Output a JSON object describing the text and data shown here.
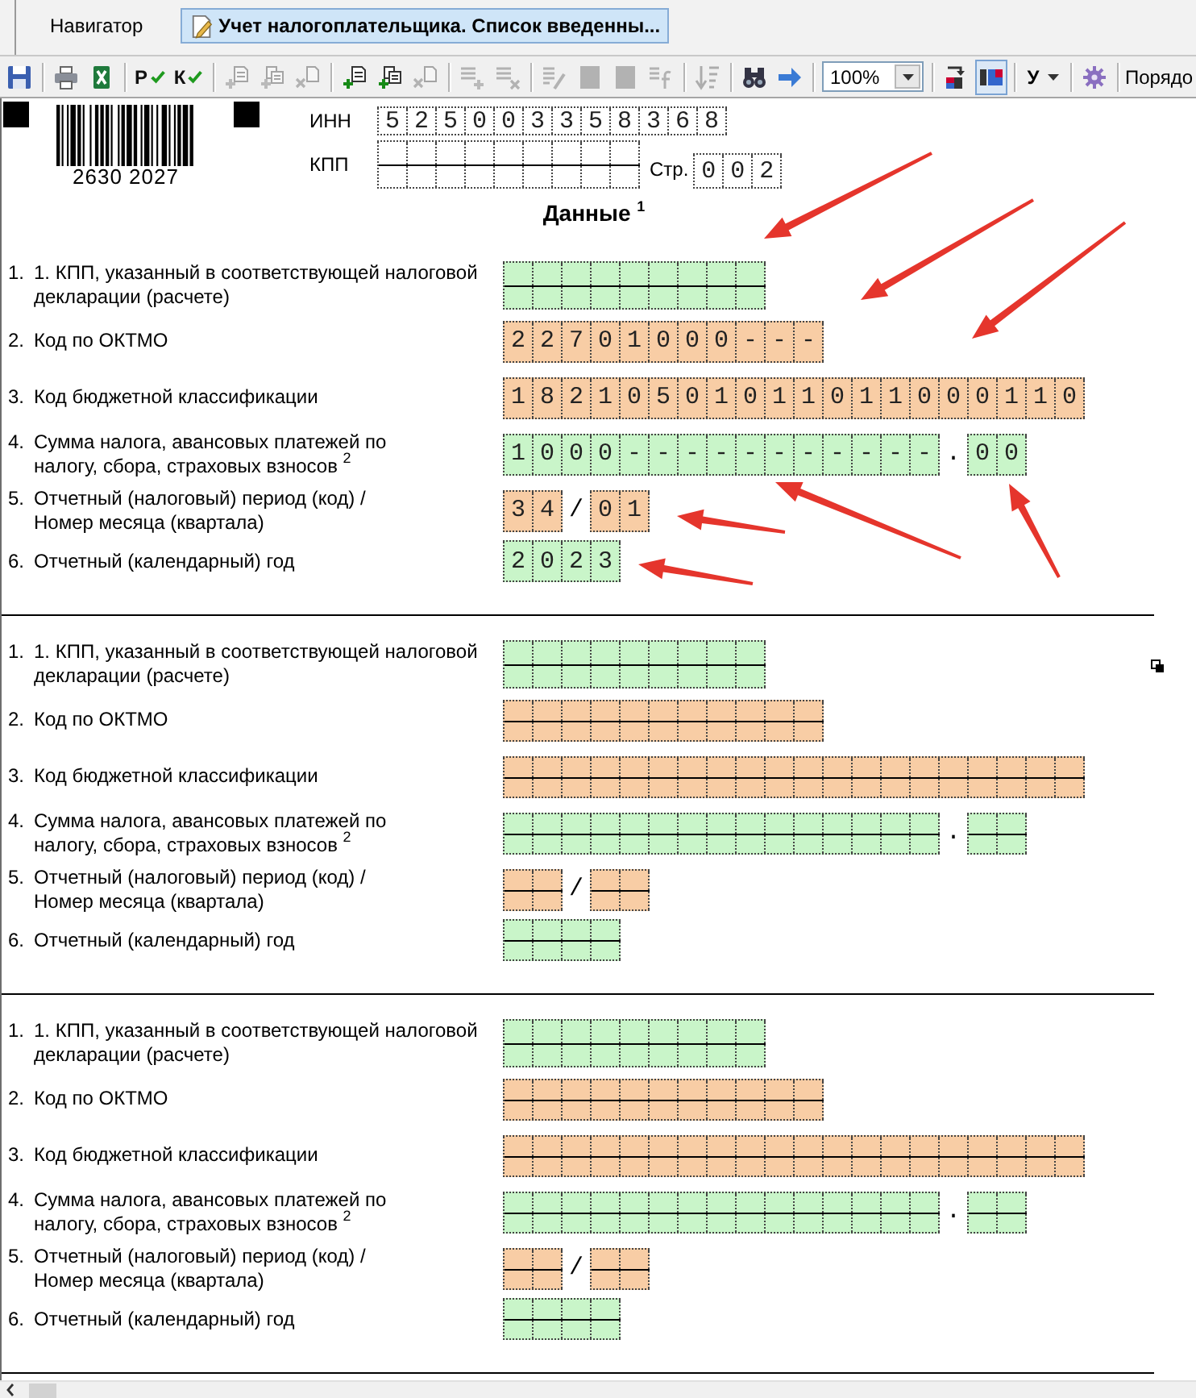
{
  "tabs": [
    {
      "kind": "plain",
      "label": "Навигатор",
      "selected": false
    },
    {
      "kind": "document",
      "label": "Учет налогоплательщика. Список введенны...",
      "selected": true
    }
  ],
  "toolbar": [
    [
      {
        "kind": "save",
        "disabled": false
      }
    ],
    [
      {
        "kind": "print",
        "disabled": false
      },
      {
        "kind": "excel",
        "disabled": false
      }
    ],
    [
      {
        "kind": "check",
        "label": "Р",
        "disabled": false
      },
      {
        "kind": "check",
        "label": "К",
        "disabled": false
      }
    ],
    [
      {
        "kind": "add-doc",
        "disabled": true
      },
      {
        "kind": "copy-doc",
        "disabled": true
      },
      {
        "kind": "delete-doc",
        "disabled": true
      }
    ],
    [
      {
        "kind": "add-doc",
        "disabled": false
      },
      {
        "kind": "copy-doc",
        "disabled": false
      },
      {
        "kind": "delete-doc",
        "disabled": true
      }
    ],
    [
      {
        "kind": "add-list",
        "disabled": true
      },
      {
        "kind": "delete-list",
        "disabled": true
      }
    ],
    [
      {
        "kind": "edit-list",
        "disabled": true
      },
      {
        "kind": "block",
        "disabled": true
      },
      {
        "kind": "block",
        "disabled": true
      },
      {
        "kind": "formula",
        "disabled": true
      }
    ],
    [
      {
        "kind": "sort",
        "disabled": true
      }
    ],
    [
      {
        "kind": "find",
        "disabled": false
      },
      {
        "kind": "next",
        "disabled": false
      }
    ],
    [
      {
        "kind": "combo",
        "value": "100%"
      }
    ],
    [
      {
        "kind": "layout",
        "disabled": false,
        "pressed": false
      },
      {
        "kind": "layout2",
        "disabled": false,
        "pressed": true
      }
    ],
    [
      {
        "kind": "menu",
        "label": "У"
      }
    ],
    [
      {
        "kind": "tool",
        "disabled": false
      }
    ],
    [
      {
        "kind": "text",
        "label": "Порядо"
      }
    ]
  ],
  "header": {
    "barcode": "2630 2027",
    "inn": {
      "label": "ИНН",
      "value": "5 2 5 0 0 3 3 5 8 3 6 8"
    },
    "kpp": {
      "label": "КПП"
    },
    "page": {
      "label": "Стр.",
      "value": "0 0 2"
    }
  },
  "title": "Данные $^{1}$",
  "blocks": [
    {
      "handle": false,
      "rows": [
        {
          "kind": "kpp",
          "number": "1.",
          "label": [
            "1. КПП, указанный в соответствующей налоговой",
            "декларации (расчете)"
          ],
          "parts": [
            {
              "color": "#c9f5c9"
            }
          ]
        },
        {
          "kind": "oktmo",
          "number": "2.",
          "label": [
            "Код по ОКТМО"
          ],
          "parts": [
            {
              "color": "#f8cda5",
              "value": "2 2 7 0 1 0 0 0 - - -"
            }
          ]
        },
        {
          "kind": "kbk",
          "number": "3.",
          "label": [
            "Код бюджетной классификации"
          ],
          "parts": [
            {
              "color": "#f8cda5",
              "value": "1 8 2 1 0 5 0 1 0 1 1 0 1 1 0 0 0 1 1 0"
            }
          ]
        },
        {
          "kind": "amount",
          "number": "4.",
          "label": [
            "Сумма налога, авансовых платежей по",
            "налогу, сбора, страховых взносов  $^{2}$"
          ],
          "separator": ".",
          "parts": [
            {
              "color": "#c9f5c9",
              "value": "1 0 0 0 - - - - - - - - - - -"
            },
            {
              "color": "#c9f5c9",
              "value": "0 0"
            }
          ]
        },
        {
          "kind": "period",
          "number": "5.",
          "label": [
            "Отчетный (налоговый) период (код) /",
            "Номер месяца (квартала)"
          ],
          "separator": "/",
          "parts": [
            {
              "color": "#f8cda5",
              "value": "3 4"
            },
            {
              "color": "#f8cda5",
              "value": "0 1"
            }
          ]
        },
        {
          "kind": "year",
          "number": "6.",
          "label": [
            "Отчетный (календарный) год"
          ],
          "parts": [
            {
              "color": "#c9f5c9",
              "value": "2 0 2 3"
            }
          ]
        }
      ]
    },
    {
      "handle": true,
      "rows": [
        {
          "kind": "kpp",
          "number": "1.",
          "label": [
            "1. КПП, указанный в соответствующей налоговой",
            "декларации (расчете)"
          ],
          "parts": [
            {
              "color": "#c9f5c9"
            }
          ]
        },
        {
          "kind": "oktmo",
          "number": "2.",
          "label": [
            "Код по ОКТМО"
          ],
          "parts": [
            {
              "color": "#f8cda5"
            }
          ]
        },
        {
          "kind": "kbk",
          "number": "3.",
          "label": [
            "Код бюджетной классификации"
          ],
          "parts": [
            {
              "color": "#f8cda5"
            }
          ]
        },
        {
          "kind": "amount",
          "number": "4.",
          "label": [
            "Сумма налога, авансовых платежей по",
            "налогу, сбора, страховых взносов  $^{2}$"
          ],
          "separator": ".",
          "parts": [
            {
              "color": "#c9f5c9"
            },
            {
              "color": "#c9f5c9"
            }
          ]
        },
        {
          "kind": "period",
          "number": "5.",
          "label": [
            "Отчетный (налоговый) период (код) /",
            "Номер месяца (квартала)"
          ],
          "separator": "/",
          "parts": [
            {
              "color": "#f8cda5"
            },
            {
              "color": "#f8cda5"
            }
          ]
        },
        {
          "kind": "year",
          "number": "6.",
          "label": [
            "Отчетный (календарный) год"
          ],
          "parts": [
            {
              "color": "#c9f5c9"
            }
          ]
        }
      ]
    },
    {
      "handle": false,
      "rows": [
        {
          "kind": "kpp",
          "number": "1.",
          "label": [
            "1. КПП, указанный в соответствующей налоговой",
            "декларации (расчете)"
          ],
          "parts": [
            {
              "color": "#c9f5c9"
            }
          ]
        },
        {
          "kind": "oktmo",
          "number": "2.",
          "label": [
            "Код по ОКТМО"
          ],
          "parts": [
            {
              "color": "#f8cda5"
            }
          ]
        },
        {
          "kind": "kbk",
          "number": "3.",
          "label": [
            "Код бюджетной классификации"
          ],
          "parts": [
            {
              "color": "#f8cda5"
            }
          ]
        },
        {
          "kind": "amount",
          "number": "4.",
          "label": [
            "Сумма налога, авансовых платежей по",
            "налогу, сбора, страховых взносов  $^{2}$"
          ],
          "separator": ".",
          "parts": [
            {
              "color": "#c9f5c9"
            },
            {
              "color": "#c9f5c9"
            }
          ]
        },
        {
          "kind": "period",
          "number": "5.",
          "label": [
            "Отчетный (налоговый) период (код) /",
            "Номер месяца (квартала)"
          ],
          "separator": "/",
          "parts": [
            {
              "color": "#f8cda5"
            },
            {
              "color": "#f8cda5"
            }
          ]
        },
        {
          "kind": "year",
          "number": "6.",
          "label": [
            "Отчетный (календарный) год"
          ],
          "parts": [
            {
              "color": "#c9f5c9"
            }
          ]
        }
      ]
    }
  ]
}
